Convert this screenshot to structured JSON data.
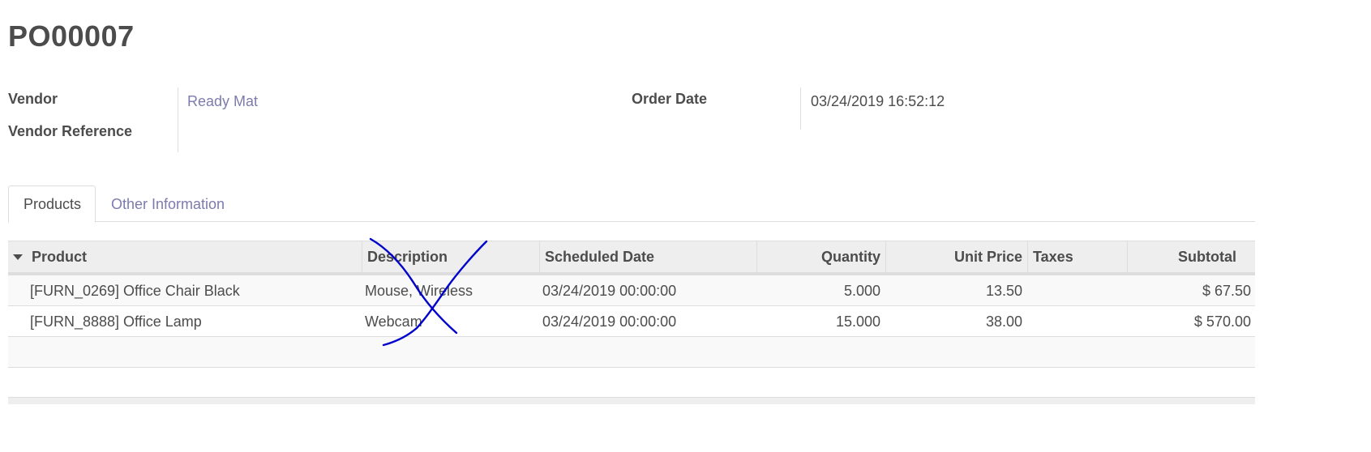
{
  "record": {
    "title": "PO00007"
  },
  "fields": {
    "vendor_label": "Vendor",
    "vendor_value": "Ready Mat",
    "vendor_reference_label": "Vendor Reference",
    "vendor_reference_value": "",
    "order_date_label": "Order Date",
    "order_date_value": "03/24/2019 16:52:12"
  },
  "tabs": [
    {
      "label": "Products",
      "active": true
    },
    {
      "label": "Other Information",
      "active": false
    }
  ],
  "table": {
    "columns": [
      "Product",
      "Description",
      "Scheduled Date",
      "Quantity",
      "Unit Price",
      "Taxes",
      "Subtotal"
    ],
    "rows": [
      {
        "product": "[FURN_0269] Office Chair Black",
        "description": "Mouse, Wireless",
        "scheduled_date": "03/24/2019 00:00:00",
        "quantity": "5.000",
        "unit_price": "13.50",
        "taxes": "",
        "subtotal": "$ 67.50"
      },
      {
        "product": "[FURN_8888] Office Lamp",
        "description": "Webcam",
        "scheduled_date": "03/24/2019 00:00:00",
        "quantity": "15.000",
        "unit_price": "38.00",
        "taxes": "",
        "subtotal": "$ 570.00"
      }
    ]
  },
  "colors": {
    "link": "#7c7bad",
    "text": "#4c4c4c",
    "header_bg": "#eeeeee",
    "border": "#dddddd",
    "annotation_stroke": "#0000cc"
  },
  "icons": {
    "sort": "caret-down-icon"
  }
}
